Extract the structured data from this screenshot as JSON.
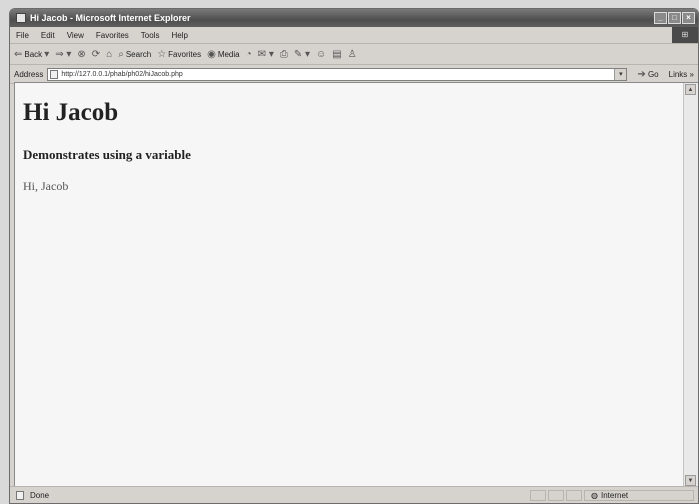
{
  "window": {
    "title": "Hi Jacob - Microsoft Internet Explorer"
  },
  "menu": [
    "File",
    "Edit",
    "View",
    "Favorites",
    "Tools",
    "Help"
  ],
  "toolbar": {
    "back": "Back",
    "search": "Search",
    "favorites": "Favorites",
    "media": "Media"
  },
  "address": {
    "label": "Address",
    "url": "http://127.0.0.1/phab/ph02/hiJacob.php",
    "go": "Go",
    "links": "Links"
  },
  "page": {
    "heading": "Hi Jacob",
    "subheading": "Demonstrates using a variable",
    "body": "Hi, Jacob"
  },
  "status": {
    "text": "Done",
    "zone": "Internet"
  }
}
